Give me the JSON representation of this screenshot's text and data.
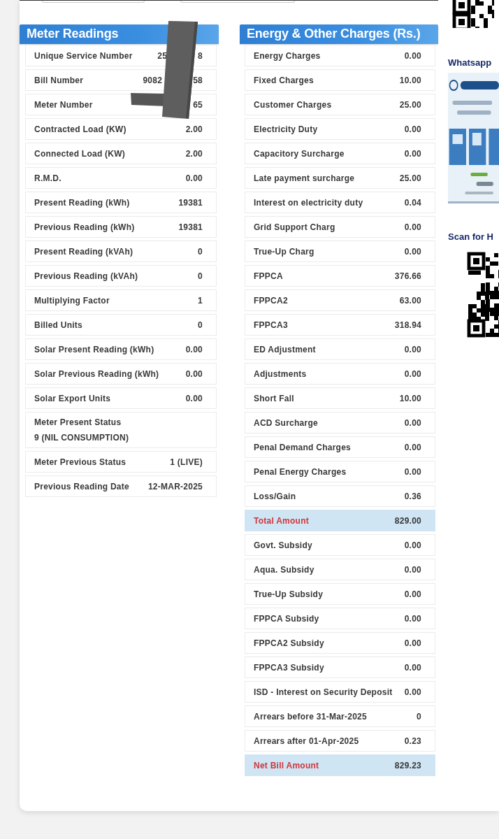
{
  "top_fields": [
    {
      "kind": "field"
    },
    {
      "kind": "field"
    }
  ],
  "meter_readings": {
    "title": "Meter Readings",
    "rows": [
      {
        "kind": "plain",
        "label": "Unique Service Number",
        "value_parts": [
          "25",
          "8"
        ]
      },
      {
        "kind": "plain",
        "label": "Bill Number",
        "value_parts": [
          "9082",
          "58"
        ]
      },
      {
        "kind": "plain",
        "label": "Meter Number",
        "value": "65"
      },
      {
        "kind": "plain",
        "label": "Contracted Load (KW)",
        "value": "2.00"
      },
      {
        "kind": "plain",
        "label": "Connected Load (KW)",
        "value": "2.00"
      },
      {
        "kind": "plain",
        "label": "R.M.D.",
        "value": "0.00"
      },
      {
        "kind": "plain",
        "label": "Present Reading (kWh)",
        "value": "19381"
      },
      {
        "kind": "plain",
        "label": "Previous Reading (kWh)",
        "value": "19381"
      },
      {
        "kind": "plain",
        "label": "Present Reading (kVAh)",
        "value": "0"
      },
      {
        "kind": "plain",
        "label": "Previous Reading (kVAh)",
        "value": "0"
      },
      {
        "kind": "plain",
        "label": "Multiplying Factor",
        "value": "1"
      },
      {
        "kind": "plain",
        "label": "Billed Units",
        "value": "0"
      },
      {
        "kind": "plain",
        "label": "Solar Present Reading (kWh)",
        "value": "0.00"
      },
      {
        "kind": "plain",
        "label": "Solar Previous Reading (kWh)",
        "value": "0.00"
      },
      {
        "kind": "plain",
        "label": "Solar Export Units",
        "value": "0.00"
      },
      {
        "kind": "stacked",
        "label": "Meter Present Status",
        "value": "9 (NIL CONSUMPTION)"
      },
      {
        "kind": "plain",
        "label": "Meter Previous Status",
        "value": "1 (LIVE)"
      },
      {
        "kind": "plain",
        "label": "Previous Reading Date",
        "value": "12-MAR-2025"
      }
    ]
  },
  "charges": {
    "title": "Energy & Other Charges (Rs.)",
    "rows": [
      {
        "kind": "plain",
        "label": "Energy Charges",
        "value": "0.00"
      },
      {
        "kind": "plain",
        "label": "Fixed Charges",
        "value": "10.00"
      },
      {
        "kind": "plain",
        "label": "Customer Charges",
        "value": "25.00"
      },
      {
        "kind": "plain",
        "label": "Electricity Duty",
        "value": "0.00"
      },
      {
        "kind": "plain",
        "label": "Capacitory Surcharge",
        "value": "0.00"
      },
      {
        "kind": "plain",
        "label": "Late payment surcharge",
        "value": "25.00"
      },
      {
        "kind": "plain",
        "label": "Interest on electricity duty",
        "value": "0.04"
      },
      {
        "kind": "plain",
        "label": "Grid Support Charg",
        "value": "0.00"
      },
      {
        "kind": "plain",
        "label": "True-Up Charg",
        "value": "0.00"
      },
      {
        "kind": "plain",
        "label": "FPPCA",
        "value": "376.66"
      },
      {
        "kind": "plain",
        "label": "FPPCA2",
        "value": "63.00"
      },
      {
        "kind": "plain",
        "label": "FPPCA3",
        "value": "318.94"
      },
      {
        "kind": "plain",
        "label": "ED Adjustment",
        "value": "0.00"
      },
      {
        "kind": "plain",
        "label": "Adjustments",
        "value": "0.00"
      },
      {
        "kind": "plain",
        "label": "Short Fall",
        "value": "10.00"
      },
      {
        "kind": "plain",
        "label": "ACD Surcharge",
        "value": "0.00"
      },
      {
        "kind": "plain",
        "label": "Penal Demand Charges",
        "value": "0.00"
      },
      {
        "kind": "plain",
        "label": "Penal Energy Charges",
        "value": "0.00"
      },
      {
        "kind": "plain",
        "label": "Loss/Gain",
        "value": "0.36"
      },
      {
        "kind": "total",
        "label": "Total Amount",
        "value": "829.00"
      },
      {
        "kind": "plain",
        "label": "Govt. Subsidy",
        "value": "0.00"
      },
      {
        "kind": "plain",
        "label": "Aqua. Subsidy",
        "value": "0.00"
      },
      {
        "kind": "plain",
        "label": "True-Up Subsidy",
        "value": "0.00"
      },
      {
        "kind": "plain",
        "label": "FPPCA Subsidy",
        "value": "0.00"
      },
      {
        "kind": "plain",
        "label": "FPPCA2 Subsidy",
        "value": "0.00"
      },
      {
        "kind": "plain",
        "label": "FPPCA3 Subsidy",
        "value": "0.00"
      },
      {
        "kind": "plain",
        "label": "ISD - Interest on Security Deposit",
        "value": "0.00"
      },
      {
        "kind": "plain",
        "label": "Arrears before 31-Mar-2025",
        "value": "0"
      },
      {
        "kind": "plain",
        "label": "Arrears after 01-Apr-2025",
        "value": "0.23"
      },
      {
        "kind": "total",
        "label": "Net Bill Amount",
        "value": "829.23"
      }
    ]
  },
  "side_panel": {
    "whatsapp_heading": "Whatsapp",
    "scan_heading": "Scan for H"
  }
}
